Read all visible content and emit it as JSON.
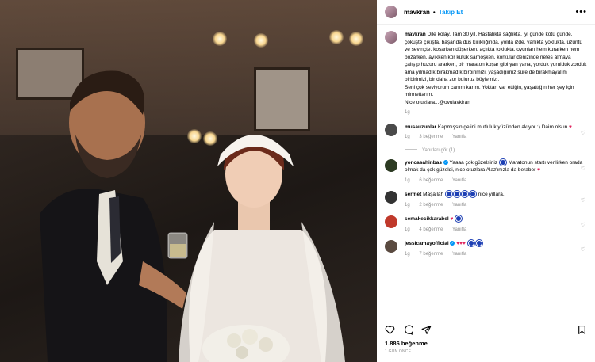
{
  "post": {
    "username": "mavkran",
    "follow_label": "Takip Et",
    "separator": "•",
    "more_label": "•••",
    "caption_user": "mavkran",
    "caption_text": "Dile kolay. Tam 30 yıl. Hastalıkta sağlıkta, iyi günde kötü günde, çokuşte çıkışta, başarıda düş kırıklığında, yolda izde, varlıkta yoklukta, üzüntü ve sevinçte, koşarken düşerken, açlıkta toklukta, oyunları hem kurarken hem bozarken, ayıkken kör kütük sarhoşken, korkular denizinde nefes almaya çalışıp huzuru ararken, bir maraton koşar gibi yan yana, yorduk yorulduk zorduk ama yılmadık bırakmadık birbirimizi, yaşadığımız süre de bırakmayalım birbirimizi, bir daha zor buluruz böylemizi.",
    "caption_text2": "Seni çok seviyorum canım karım. Yoktan var ettiğin, yaşattığın her şey için minnettarım.",
    "caption_text3": "Nice otuzlara...@ovulavkiran",
    "caption_time": "1g"
  },
  "comments": [
    {
      "user": "musauzunlar",
      "text": "Kapmışsın gelini mutluluk yüzünden akıyor :) Daim olsun",
      "time": "1g",
      "likes": "3 beğenme",
      "reply": "Yanıtla",
      "avatar_color": "#4a4a4a"
    },
    {
      "user": "yoncasahinbas",
      "text": "Yaaaa çok güzelsiniz",
      "text2": "Maratonun startı verilirken orada olmak da çok güzeldi, nice otuzlara Alaz'ınızla da beraber",
      "time": "1g",
      "likes": "6 beğenme",
      "reply": "Yanıtla",
      "avatar_color": "#2c3a22"
    },
    {
      "user": "sermet",
      "text": "Maşallah",
      "text2": "nice yıllara..",
      "time": "1g",
      "likes": "2 beğenme",
      "reply": "Yanıtla",
      "avatar_color": "#333333"
    },
    {
      "user": "semakecikkarabel",
      "text": "",
      "time": "1g",
      "likes": "4 beğenme",
      "reply": "Yanıtla",
      "avatar_color": "#c0392b"
    },
    {
      "user": "jessicamayofficial",
      "text": "",
      "time": "1g",
      "likes": "7 beğenme",
      "reply": "Yanıtla",
      "avatar_color": "#5a4a40"
    }
  ],
  "view_replies": "Yanıtları gör (1)",
  "footer": {
    "likes": "1.886 beğenme",
    "time_ago": "1 GÜN ÖNCE"
  }
}
